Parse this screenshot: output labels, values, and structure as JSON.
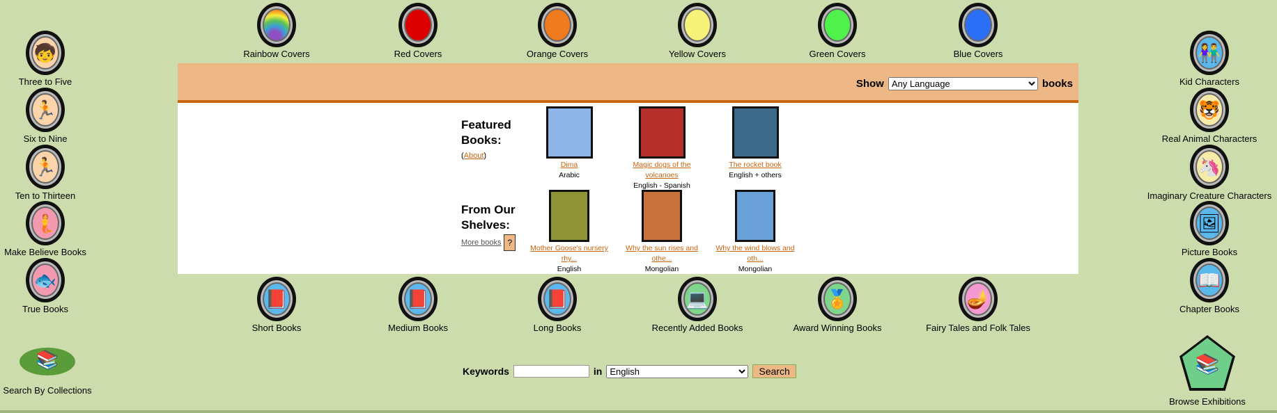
{
  "top_nav": [
    {
      "label": "Rainbow Covers",
      "color": "rainbow"
    },
    {
      "label": "Red Covers",
      "color": "#dd0000"
    },
    {
      "label": "Orange Covers",
      "color": "#f07a1e"
    },
    {
      "label": "Yellow Covers",
      "color": "#f7f27a"
    },
    {
      "label": "Green Covers",
      "color": "#4ff24a"
    },
    {
      "label": "Blue Covers",
      "color": "#2a6ef5"
    }
  ],
  "bottom_nav": [
    {
      "label": "Short Books",
      "icon": "book-icon"
    },
    {
      "label": "Medium Books",
      "icon": "book-icon"
    },
    {
      "label": "Long Books",
      "icon": "book-icon"
    },
    {
      "label": "Recently Added Books",
      "icon": "computer-icon"
    },
    {
      "label": "Award Winning Books",
      "icon": "medal-icon"
    },
    {
      "label": "Fairy Tales and Folk Tales",
      "icon": "lamp-icon"
    }
  ],
  "left_nav": [
    {
      "label": "Three to Five",
      "icon": "child-icon"
    },
    {
      "label": "Six to Nine",
      "icon": "child-running-icon"
    },
    {
      "label": "Ten to Thirteen",
      "icon": "runner-icon"
    },
    {
      "label": "Make Believe Books",
      "icon": "mermaid-icon"
    },
    {
      "label": "True Books",
      "icon": "fish-icon"
    }
  ],
  "right_nav": [
    {
      "label": "Kid Characters",
      "icon": "kids-icon"
    },
    {
      "label": "Real Animal Characters",
      "icon": "tiger-icon"
    },
    {
      "label": "Imaginary Creature Characters",
      "icon": "unicorn-icon"
    },
    {
      "label": "Picture Books",
      "icon": "picture-icon"
    },
    {
      "label": "Chapter Books",
      "icon": "open-book-icon"
    }
  ],
  "search_collections": "Search By Collections",
  "browse_exhibitions": "Browse Exhibitions",
  "header": {
    "show": "Show",
    "language": "Any Language",
    "books": "books"
  },
  "featured": {
    "title": "Featured Books:",
    "about_open": "(",
    "about": "About",
    "about_close": ")",
    "books": [
      {
        "title": "Dima",
        "lang": "Arabic",
        "cover": "#8fb4e8"
      },
      {
        "title": "Magic dogs of the volcanoes",
        "lang": "English - Spanish",
        "cover": "#b5302a"
      },
      {
        "title": "The rocket book",
        "lang": "English + others",
        "cover": "#3e6a8a"
      }
    ]
  },
  "shelves": {
    "title": "From Our Shelves:",
    "more": "More books",
    "help": "?",
    "books": [
      {
        "title": "Mother Goose's nursery rhy...",
        "lang": "English",
        "cover": "#8f9436"
      },
      {
        "title": "Why the sun rises and othe...",
        "lang": "Mongolian",
        "cover": "#c9713a"
      },
      {
        "title": "Why the wind blows and oth...",
        "lang": "Mongolian",
        "cover": "#6aa0d8"
      }
    ]
  },
  "search": {
    "keywords": "Keywords",
    "value": "",
    "in": "in",
    "language": "English",
    "button": "Search"
  }
}
